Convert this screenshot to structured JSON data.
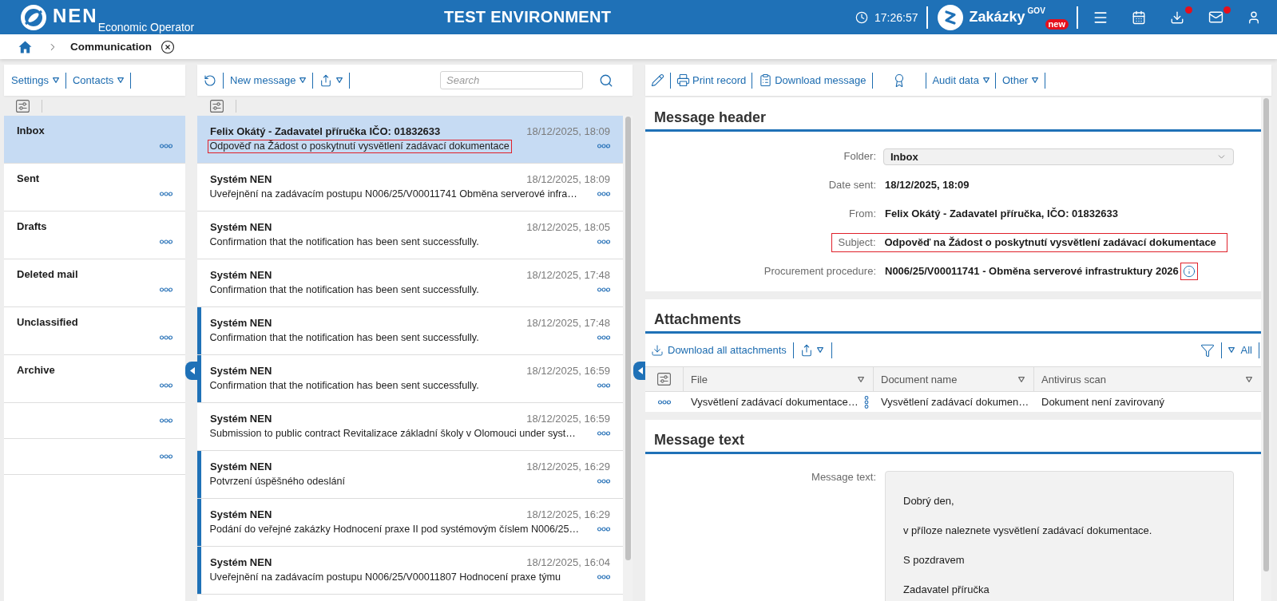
{
  "top_bar": {
    "logo_text": "NEN",
    "subtitle": "Economic Operator",
    "environment": "TEST ENVIRONMENT",
    "time": "17:26:57",
    "portal": {
      "name": "Zakázky",
      "superscript": "GOV",
      "badge": "new"
    },
    "download_alert": true,
    "mail_alert": true
  },
  "breadcrumb": {
    "current": "Communication"
  },
  "folder_toolbar": {
    "settings": "Settings",
    "contacts": "Contacts"
  },
  "folders": [
    {
      "name": "Inbox",
      "selected": true
    },
    {
      "name": "Sent",
      "selected": false
    },
    {
      "name": "Drafts",
      "selected": false
    },
    {
      "name": "Deleted mail",
      "selected": false
    },
    {
      "name": "Unclassified",
      "selected": false
    },
    {
      "name": "Archive",
      "selected": false
    },
    {
      "selected": false
    },
    {
      "selected": false
    }
  ],
  "message_toolbar": {
    "new_message": "New message",
    "search": {
      "placeholder": "Search"
    }
  },
  "messages": [
    {
      "sender": "Felix Okátý - Zadavatel příručka IČO: 01832633",
      "date": "18/12/2025, 18:09",
      "subject": "Odpověď na Žádost o poskytnutí vysvětlení zadávací dokumentace",
      "selected": true,
      "marked": false,
      "highlighted": true
    },
    {
      "sender": "Systém NEN",
      "date": "18/12/2025, 18:09",
      "subject": "Uveřejnění na zadávacím postupu N006/25/V00011741 Obměna serverové infra…",
      "selected": false,
      "marked": false,
      "highlighted": false
    },
    {
      "sender": "Systém NEN",
      "date": "18/12/2025, 18:05",
      "subject": "Confirmation that the notification has been sent successfully.",
      "selected": false,
      "marked": false,
      "highlighted": false
    },
    {
      "sender": "Systém NEN",
      "date": "18/12/2025, 17:48",
      "subject": "Confirmation that the notification has been sent successfully.",
      "selected": false,
      "marked": false,
      "highlighted": false
    },
    {
      "sender": "Systém NEN",
      "date": "18/12/2025, 17:48",
      "subject": "Confirmation that the notification has been sent successfully.",
      "selected": false,
      "marked": true,
      "highlighted": false
    },
    {
      "sender": "Systém NEN",
      "date": "18/12/2025, 16:59",
      "subject": "Confirmation that the notification has been sent successfully.",
      "selected": false,
      "marked": true,
      "highlighted": false
    },
    {
      "sender": "Systém NEN",
      "date": "18/12/2025, 16:59",
      "subject": "Submission to public contract Revitalizace základní školy v Olomouci under syst…",
      "selected": false,
      "marked": false,
      "highlighted": false
    },
    {
      "sender": "Systém NEN",
      "date": "18/12/2025, 16:29",
      "subject": "Potvrzení úspěšného odeslání",
      "selected": false,
      "marked": true,
      "highlighted": false
    },
    {
      "sender": "Systém NEN",
      "date": "18/12/2025, 16:29",
      "subject": "Podání do veřejné zakázky Hodnocení praxe II pod systémovým číslem N006/25…",
      "selected": false,
      "marked": true,
      "highlighted": false
    },
    {
      "sender": "Systém NEN",
      "date": "18/12/2025, 16:04",
      "subject": "Uveřejnění na zadávacím postupu N006/25/V00011807 Hodnocení praxe týmu",
      "selected": false,
      "marked": true,
      "highlighted": false
    }
  ],
  "detail_toolbar": {
    "print_record": "Print record",
    "download_message": "Download message",
    "audit_data": "Audit data",
    "other": "Other"
  },
  "message_header": {
    "title": "Message header",
    "fields": [
      {
        "kind": "select",
        "label": "Folder:",
        "value": "Inbox",
        "highlighted": false
      },
      {
        "kind": "text",
        "label": "Date sent:",
        "value": "18/12/2025, 18:09",
        "highlighted": false
      },
      {
        "kind": "text",
        "label": "From:",
        "value": "Felix Okátý - Zadavatel příručka, IČO: 01832633",
        "highlighted": false
      },
      {
        "kind": "text",
        "label": "Subject:",
        "value": "Odpověď na Žádost o poskytnutí vysvětlení zadávací dokumentace",
        "highlighted": true
      },
      {
        "kind": "info",
        "label": "Procurement procedure:",
        "value": "N006/25/V00011741 - Obměna serverové infrastruktury 2026",
        "highlighted": false,
        "info_highlighted": true
      }
    ]
  },
  "attachments": {
    "title": "Attachments",
    "download_all": "Download all attachments",
    "filter": "All",
    "columns": [
      {
        "label": "File"
      },
      {
        "label": "Document name"
      },
      {
        "label": "Antivirus scan"
      }
    ],
    "rows": [
      {
        "cells": [
          "Vysvětlení zadávací dokumentace…",
          "Vysvětlení zadávací dokumen…",
          "Dokument není zavirovaný"
        ]
      }
    ]
  },
  "message_text": {
    "title": "Message text",
    "label": "Message text:",
    "paragraphs": [
      "Dobrý den,",
      "v příloze naleznete vysvětlení zadávací dokumentace.",
      "S pozdravem",
      "Zadavatel příručka"
    ]
  }
}
